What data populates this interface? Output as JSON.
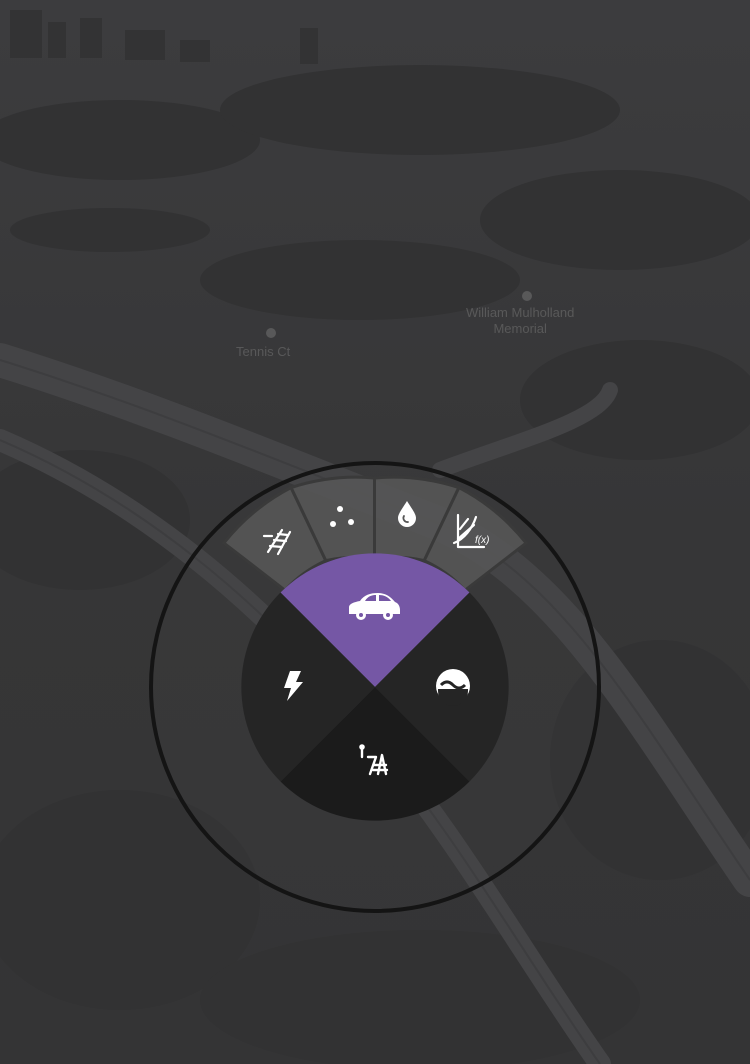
{
  "map": {
    "labels": {
      "tennis": "Tennis Ct",
      "memorial_line1": "William Mulholland",
      "memorial_line2": "Memorial"
    }
  },
  "radial_menu": {
    "colors": {
      "selected": "#7557a5",
      "ring": "#141414",
      "wedge_dark": "#252525",
      "wedge_darker": "#1b1b1b",
      "outer_tab": "#565656"
    },
    "outer_tabs": [
      {
        "icon": "rail-track-icon"
      },
      {
        "icon": "dots-scatter-icon"
      },
      {
        "icon": "water-drop-icon"
      },
      {
        "icon": "function-graph-icon"
      }
    ],
    "wedges": [
      {
        "icon": "car-icon",
        "selected": true
      },
      {
        "icon": "water-level-icon",
        "selected": false
      },
      {
        "icon": "rail-crossing-icon",
        "selected": false
      },
      {
        "icon": "lightning-icon",
        "selected": false
      }
    ]
  }
}
